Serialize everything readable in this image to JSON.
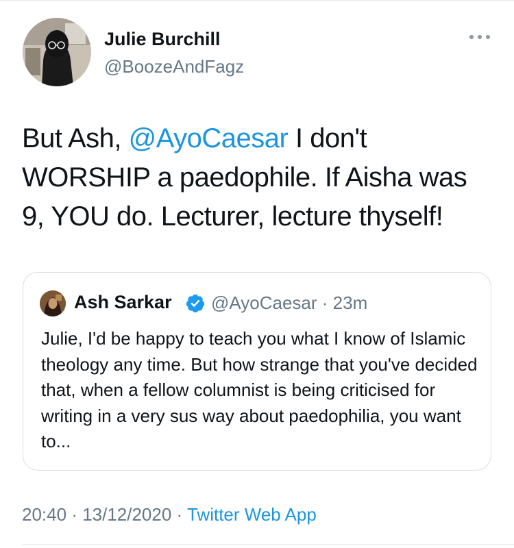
{
  "author": {
    "name": "Julie Burchill",
    "handle": "@BoozeAndFagz"
  },
  "tweet": {
    "text_before": "But Ash, ",
    "mention": "@AyoCaesar",
    "text_after": " I don't WORSHIP a paedophile. If Aisha was 9, YOU do. Lecturer, lecture thyself!"
  },
  "quoted_tweet": {
    "name": "Ash Sarkar",
    "handle": "@AyoCaesar",
    "separator": " · ",
    "time": "23m",
    "verified": true,
    "text": "Julie, I'd be happy to teach you what I know of Islamic theology any time. But how strange that you've decided that, when a fellow columnist is being criticised for writing in a very sus way about paedophilia, you want to..."
  },
  "meta": {
    "time": "20:40",
    "separator": " · ",
    "date": "13/12/2020",
    "app": "Twitter Web App"
  },
  "colors": {
    "link": "#1b95e0",
    "secondary_text": "#657786",
    "border": "#d5dde3",
    "verified_badge": "#1d9bf0"
  },
  "icons": {
    "more": "more-horizontal-icon",
    "verified": "verified-badge-icon"
  }
}
